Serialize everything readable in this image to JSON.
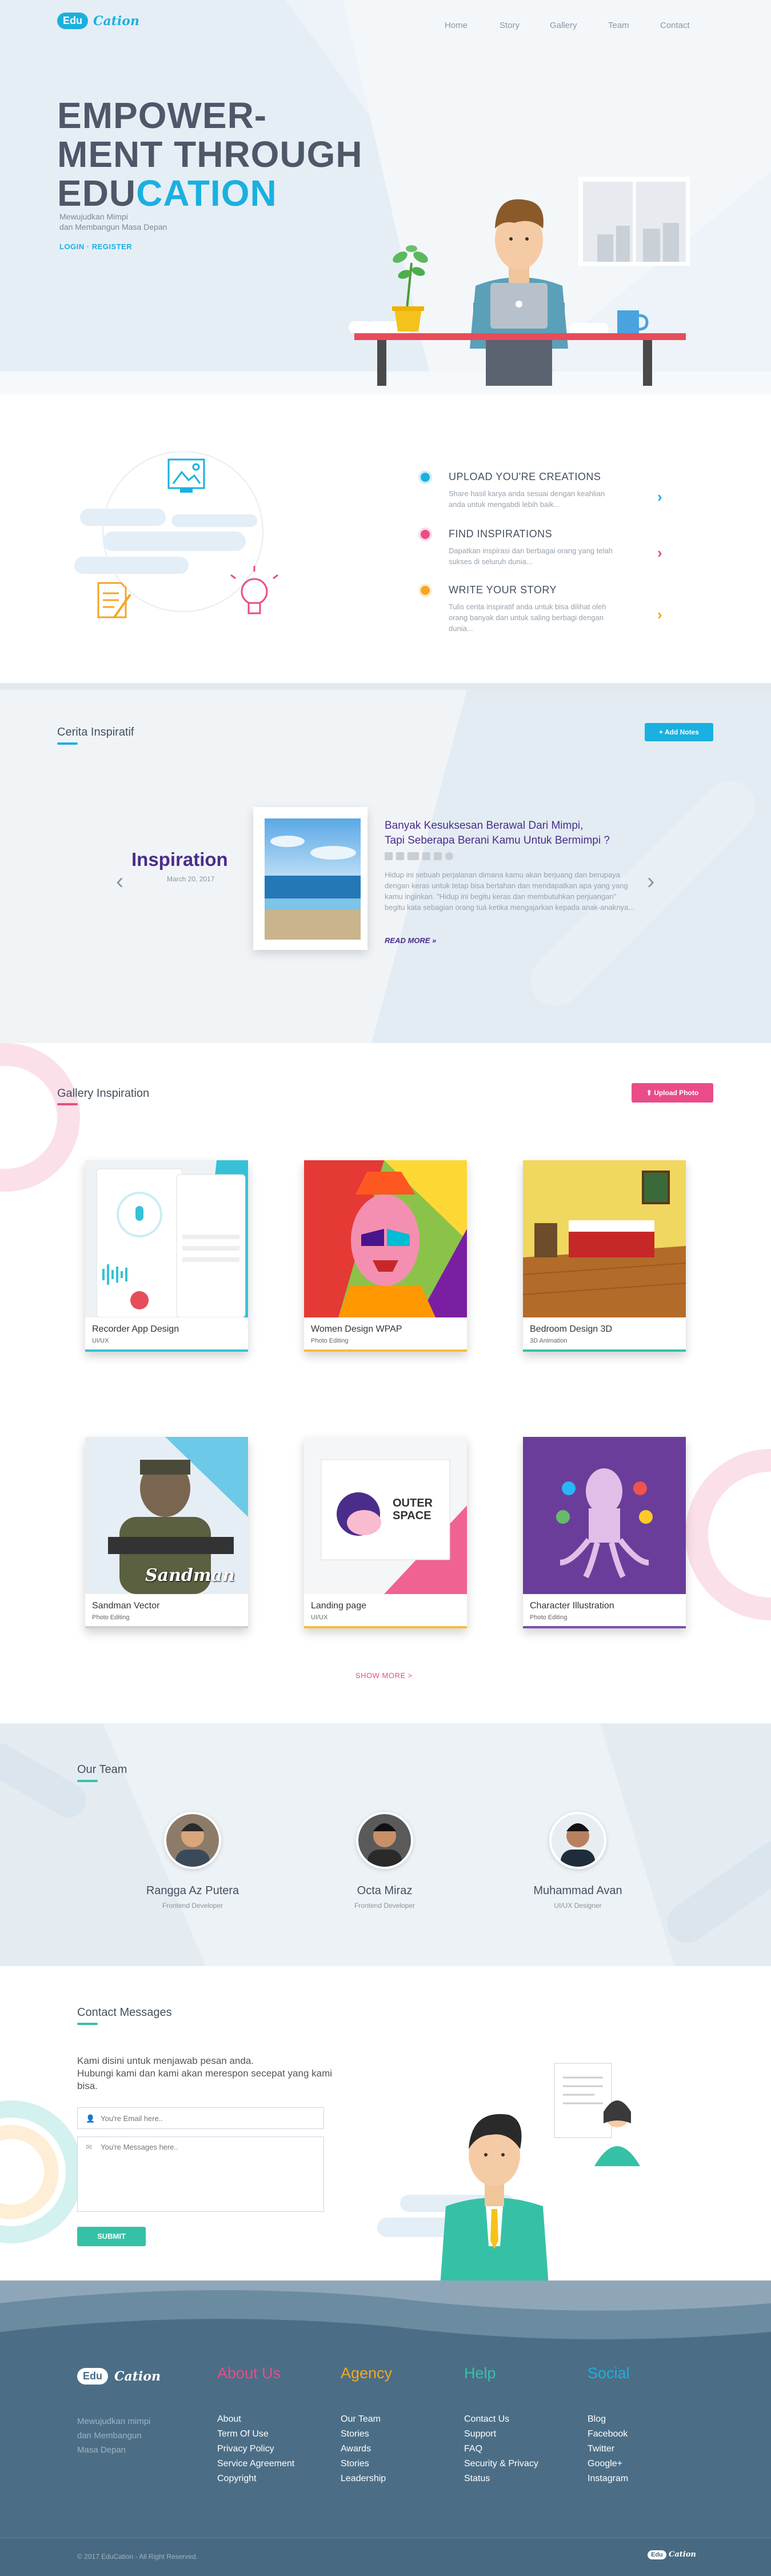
{
  "nav": {
    "logo_pill": "Edu",
    "logo_script": "Cation",
    "links": [
      "Home",
      "Story",
      "Gallery",
      "Team",
      "Contact"
    ]
  },
  "hero": {
    "title_line1": "EMPOWER-",
    "title_line2": "MENT THROUGH",
    "title_line3_a": "EDU",
    "title_line3_b": "CATION",
    "sub1": "Mewujudkan Mimpi",
    "sub2": "dan Membangun Masa Depan",
    "link_login": "LOGIN",
    "link_sep": " · ",
    "link_register": "REGISTER"
  },
  "features": [
    {
      "title": "UPLOAD YOU'RE CREATIONS",
      "desc": "Share hasil karya anda sesuai dengan keahlian anda untuk mengabdi lebih baik...",
      "color": "#1ab0e0"
    },
    {
      "title": "FIND INSPIRATIONS",
      "desc": "Dapatkan inspirasi dan berbagai orang yang telah sukses di seluruh dunia...",
      "color": "#ea4c89"
    },
    {
      "title": "WRITE YOUR STORY",
      "desc": "Tulis cerita inspiratif anda untuk bisa dilihat oleh orang banyak dan untuk saling berbagi dengan dunia...",
      "color": "#f5a623"
    }
  ],
  "stories": {
    "title": "Cerita Inspiratif",
    "add_button": "+ Add Notes",
    "label": "Inspiration",
    "date": "March 20, 2017",
    "headline1": "Banyak Kesuksesan Berawal Dari Mimpi,",
    "headline2": "Tapi Seberapa Berani Kamu Untuk Bermimpi ?",
    "body": "Hidup ini sebuah perjalanan dimana kamu akan berjuang dan berupaya dengan keras untuk tetap bisa bertahan dan mendapatkan apa yang yang kamu inginkan. \"Hidup ini begitu keras dan membutuhkan perjuangan\" begitu kata sebagian orang tuá ketika mengajarkan kepada anak-anaknya...",
    "read_more": "READ MORE »",
    "prev": "‹",
    "next": "›"
  },
  "gallery": {
    "title": "Gallery Inspiration",
    "upload_button": "Upload Photo",
    "show_more": "SHOW MORE >",
    "items": [
      {
        "title": "Recorder App Design",
        "category": "UI/UX",
        "bar": "#36c1d6"
      },
      {
        "title": "Women Design WPAP",
        "category": "Photo Editing",
        "bar": "#f5c037"
      },
      {
        "title": "Bedroom Design 3D",
        "category": "3D Animation",
        "bar": "#36c1a6"
      },
      {
        "title": "Sandman Vector",
        "category": "Photo Editing",
        "bar": "#d0d0d0"
      },
      {
        "title": "Landing page",
        "category": "UI/UX",
        "bar": "#f5c037"
      },
      {
        "title": "Character Illustration",
        "category": "Photo Editing",
        "bar": "#7b4fb0"
      }
    ],
    "thumb_text_sandman": "Sandman",
    "thumb_text_outer1": "OUTER",
    "thumb_text_outer2": "SPACE"
  },
  "team": {
    "title": "Our Team",
    "members": [
      {
        "name": "Rangga Az Putera",
        "role": "Frontend Developer"
      },
      {
        "name": "Octa Miraz",
        "role": "Frontend Developer"
      },
      {
        "name": "Muhammad Avan",
        "role": "UI/UX Designer"
      }
    ]
  },
  "contact": {
    "title": "Contact Messages",
    "intro1": "Kami disini untuk menjawab pesan anda.",
    "intro2": "Hubungi kami dan kami akan merespon secepat yang kami",
    "intro3": "bisa.",
    "email_placeholder": "You're Email here..",
    "message_placeholder": "You're Messages here..",
    "submit": "SUBMIT"
  },
  "footer": {
    "logo_pill": "Edu",
    "logo_script": "Cation",
    "tagline1": "Mewujudkan mimpi",
    "tagline2": "dan Membangun",
    "tagline3": "Masa Depan",
    "columns": [
      {
        "head": "About Us",
        "color": "#ea4c89",
        "items": [
          "About",
          "Term Of Use",
          "Privacy Policy",
          "Service Agreement",
          "Copyright"
        ]
      },
      {
        "head": "Agency",
        "color": "#f5a623",
        "items": [
          "Our Team",
          "Stories",
          "Awards",
          "Stories",
          "Leadership"
        ]
      },
      {
        "head": "Help",
        "color": "#36c1a6",
        "items": [
          "Contact Us",
          "Support",
          "FAQ",
          "Security & Privacy",
          "Status"
        ]
      },
      {
        "head": "Social",
        "color": "#1ab0e0",
        "items": [
          "Blog",
          "Facebook",
          "Twitter",
          "Google+",
          "Instagram"
        ]
      }
    ],
    "copyright": "© 2017 EduCation - All Right Reserved.",
    "mini_logo_pill": "Edu",
    "mini_logo_script": "Cation"
  },
  "colors": {
    "blue": "#1ab0e0",
    "pink": "#ea4c89",
    "orange": "#f5a623",
    "teal": "#36c1a6",
    "dark": "#4b6e86"
  }
}
